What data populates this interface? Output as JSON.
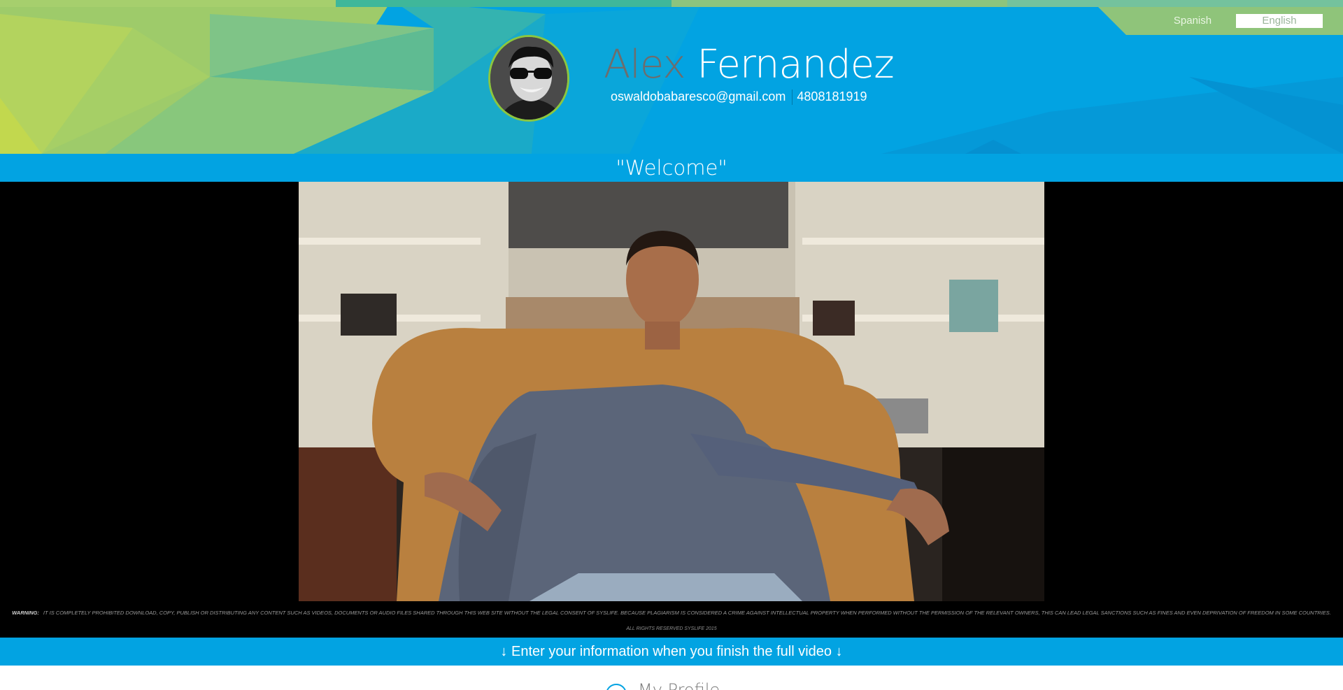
{
  "header": {
    "first_name": "Alex",
    "last_name": "Fernandez",
    "email": "oswaldobabaresco@gmail.com",
    "phone": "4808181919"
  },
  "language": {
    "spanish": "Spanish",
    "english": "English",
    "selected": "English"
  },
  "welcome": {
    "title": "\"Welcome\""
  },
  "video": {
    "warning_label": "WARNING:",
    "warning_text": "IT IS COMPLETELY PROHIBITED DOWNLOAD, COPY, PUBLISH OR DISTRIBUTING ANY CONTENT SUCH AS VIDEOS, DOCUMENTS OR AUDIO FILES SHARED THROUGH THIS WEB SITE WITHOUT THE LEGAL CONSENT OF SYSLIFE. BECAUSE PLAGIARISM IS CONSIDERED A CRIME AGAINST INTELLECTUAL PROPERTY WHEN PERFORMED WITHOUT THE PERMISSION OF THE RELEVANT OWNERS, THIS CAN LEAD LEGAL SANCTIONS SUCH AS FINES AND EVEN DEPRIVATION OF FREEDOM IN SOME COUNTRIES.",
    "rights": "ALL RIGHTS RESERVED SYSLIFE 2015"
  },
  "info_bar": {
    "text": "↓ Enter your information when you finish the full video ↓"
  },
  "profile": {
    "label": "My Profile",
    "icon": "user-circle-icon"
  },
  "colors": {
    "primary_blue": "#02a3e2",
    "accent_green": "#8cc63f",
    "lang_tab_green": "#8fc47a"
  }
}
